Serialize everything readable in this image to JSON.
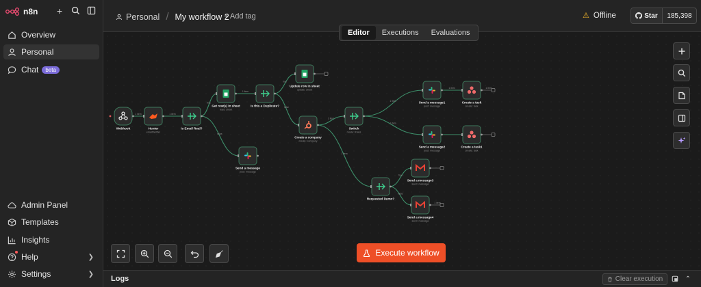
{
  "app": {
    "name": "n8n"
  },
  "sidebar": {
    "top": [
      {
        "id": "overview",
        "label": "Overview",
        "icon": "home-icon"
      },
      {
        "id": "personal",
        "label": "Personal",
        "icon": "user-icon",
        "active": true
      },
      {
        "id": "chat",
        "label": "Chat",
        "icon": "chat-icon",
        "badge": "beta"
      }
    ],
    "bottom": [
      {
        "id": "admin",
        "label": "Admin Panel",
        "icon": "cloud-icon"
      },
      {
        "id": "templates",
        "label": "Templates",
        "icon": "box-icon"
      },
      {
        "id": "insights",
        "label": "Insights",
        "icon": "bar-chart-icon"
      },
      {
        "id": "help",
        "label": "Help",
        "icon": "help-icon",
        "submenu": true
      },
      {
        "id": "settings",
        "label": "Settings",
        "icon": "gear-icon",
        "submenu": true
      }
    ]
  },
  "header": {
    "project": "Personal",
    "workflow_title": "My workflow 2",
    "add_tag": "+ Add tag",
    "status": "Offline",
    "github": {
      "label": "Star",
      "count": "185,398"
    }
  },
  "tabs": [
    {
      "label": "Editor",
      "active": true
    },
    {
      "label": "Executions"
    },
    {
      "label": "Evaluations"
    }
  ],
  "workflow": {
    "nodes": [
      {
        "id": "webhook",
        "label": "Webhook",
        "sub": "",
        "icon": "webhook-icon"
      },
      {
        "id": "hunter",
        "label": "Hunter",
        "sub": "emailVerifier",
        "icon": "hunter-icon"
      },
      {
        "id": "isemail",
        "label": "Is Email Real?",
        "sub": "",
        "icon": "if-icon"
      },
      {
        "id": "getrows",
        "label": "Get row(s) in sheet",
        "sub": "read: sheet",
        "icon": "sheets-icon"
      },
      {
        "id": "isdup",
        "label": "Is this a Duplicate?",
        "sub": "",
        "icon": "if-icon"
      },
      {
        "id": "updaterow",
        "label": "Update row in sheet",
        "sub": "update: sheet",
        "icon": "sheets-icon"
      },
      {
        "id": "createco",
        "label": "Create a company",
        "sub": "create: company",
        "icon": "hubspot-icon"
      },
      {
        "id": "switch",
        "label": "Switch",
        "sub": "mode: Rules",
        "icon": "switch-icon"
      },
      {
        "id": "sendmsg",
        "label": "Send a message",
        "sub": "post: message",
        "icon": "slack-icon"
      },
      {
        "id": "sendmsg1",
        "label": "Send a message1",
        "sub": "post: message",
        "icon": "slack-icon"
      },
      {
        "id": "task",
        "label": "Create a task",
        "sub": "create: task",
        "icon": "asana-icon"
      },
      {
        "id": "sendmsg2",
        "label": "Send a message2",
        "sub": "post: message",
        "icon": "slack-icon"
      },
      {
        "id": "task1",
        "label": "Create a task1",
        "sub": "create: task",
        "icon": "asana-icon"
      },
      {
        "id": "reqdemo",
        "label": "Requested Demo?",
        "sub": "",
        "icon": "if-icon"
      },
      {
        "id": "sendmsg3",
        "label": "Send a message3",
        "sub": "send: message",
        "icon": "gmail-icon"
      },
      {
        "id": "sendmsg4",
        "label": "Send a message4",
        "sub": "send: message",
        "icon": "gmail-icon"
      }
    ],
    "edge_labels": {
      "e1": "1 item",
      "e2": "1 item",
      "e3": "1 item",
      "e4": "1 item",
      "e5": "1 item",
      "e6": "1 item",
      "e7": "1 item",
      "e8": "1 item",
      "e9": "1 item",
      "e10": "1 item"
    },
    "branch_labels": {
      "true": "true",
      "false": "false"
    }
  },
  "toolbar": {
    "execute_label": "Execute workflow"
  },
  "logs": {
    "title": "Logs",
    "clear_label": "Clear execution"
  },
  "colors": {
    "accent": "#ee4f27",
    "edge": "#3d8f6a",
    "node_bg": "#2b2b2b",
    "beta": "#7b6cd9",
    "warning": "#f0b429"
  }
}
